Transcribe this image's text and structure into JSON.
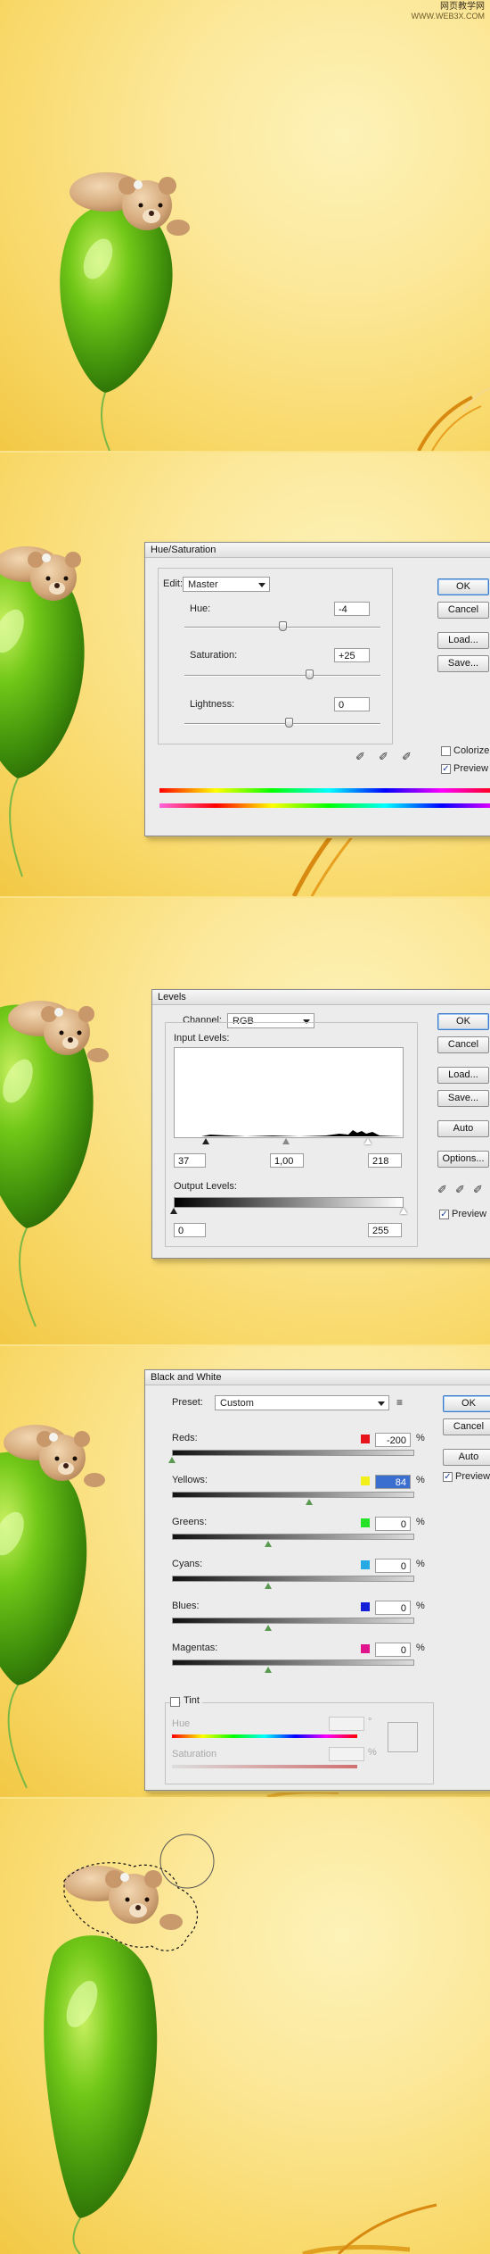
{
  "watermark": {
    "line1": "网页教学网",
    "line2": "WWW.WEB3X.COM"
  },
  "hue_saturation": {
    "title": "Hue/Saturation",
    "edit_label": "Edit:",
    "edit_value": "Master",
    "hue_label": "Hue:",
    "hue_value": "-4",
    "saturation_label": "Saturation:",
    "saturation_value": "+25",
    "lightness_label": "Lightness:",
    "lightness_value": "0",
    "ok": "OK",
    "cancel": "Cancel",
    "load": "Load...",
    "save": "Save...",
    "colorize": "Colorize",
    "colorize_checked": false,
    "preview": "Preview",
    "preview_checked": true
  },
  "levels": {
    "title": "Levels",
    "channel_label": "Channel:",
    "channel_value": "RGB",
    "input_levels_label": "Input Levels:",
    "input_black": "37",
    "input_gamma": "1,00",
    "input_white": "218",
    "output_levels_label": "Output Levels:",
    "output_black": "0",
    "output_white": "255",
    "ok": "OK",
    "cancel": "Cancel",
    "load": "Load...",
    "save": "Save...",
    "auto": "Auto",
    "options": "Options...",
    "preview": "Preview",
    "preview_checked": true
  },
  "black_and_white": {
    "title": "Black and White",
    "preset_label": "Preset:",
    "preset_value": "Custom",
    "ok": "OK",
    "cancel": "Cancel",
    "auto": "Auto",
    "preview": "Preview",
    "preview_checked": true,
    "percent": "%",
    "sliders": [
      {
        "label": "Reds:",
        "value": "-200",
        "color": "#e8141c",
        "pos": 0.0
      },
      {
        "label": "Yellows:",
        "value": "84",
        "color": "#f3ef18",
        "pos": 0.57
      },
      {
        "label": "Greens:",
        "value": "0",
        "color": "#27e327",
        "pos": 0.4
      },
      {
        "label": "Cyans:",
        "value": "0",
        "color": "#27a9e3",
        "pos": 0.4
      },
      {
        "label": "Blues:",
        "value": "0",
        "color": "#1420d8",
        "pos": 0.4
      },
      {
        "label": "Magentas:",
        "value": "0",
        "color": "#e0148c",
        "pos": 0.4
      }
    ],
    "tint_label": "Tint",
    "tint_checked": false,
    "hue_label": "Hue",
    "hue_degree": "°",
    "saturation_label": "Saturation",
    "saturation_percent": "%"
  }
}
